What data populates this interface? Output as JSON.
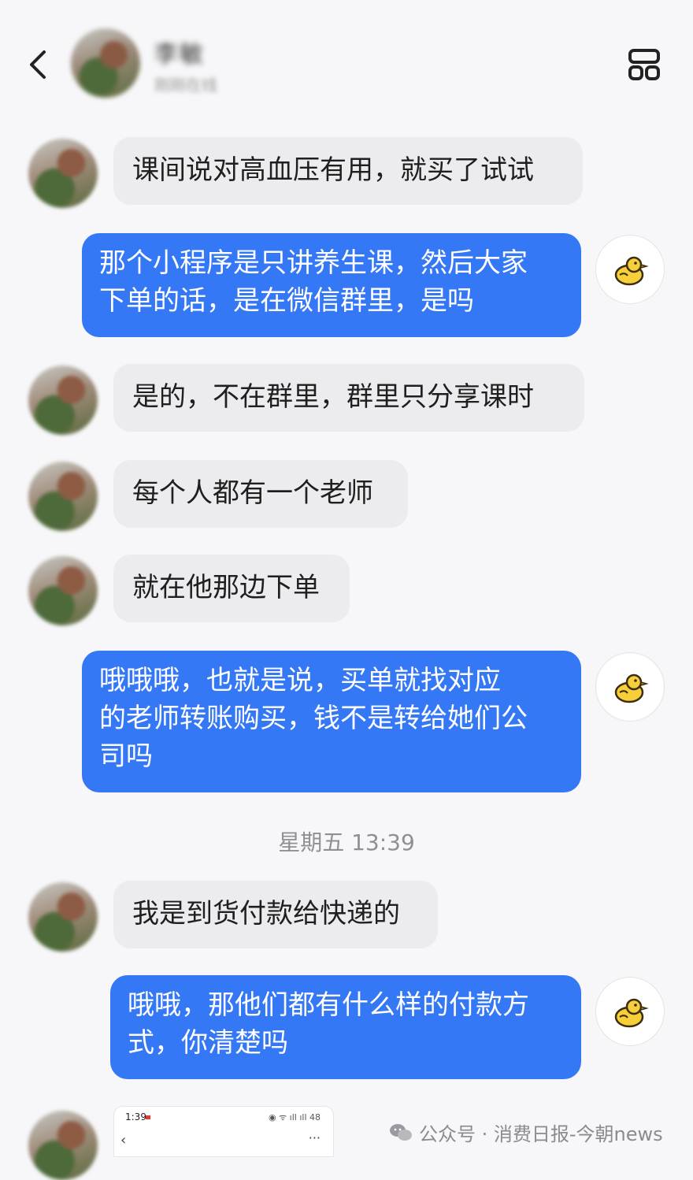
{
  "header": {
    "contact_name": "李敏",
    "contact_status": "刚刚在线"
  },
  "messages": [
    {
      "from": "other",
      "text": "课间说对高血压有用，就买了试试"
    },
    {
      "from": "self",
      "lines": [
        "那个小程序是只讲养生课，然后大家",
        "下单的话，是在微信群里，是吗"
      ]
    },
    {
      "from": "other",
      "text": "是的，不在群里，群里只分享课时"
    },
    {
      "from": "other",
      "text": "每个人都有一个老师"
    },
    {
      "from": "other",
      "text": "就在他那边下单"
    },
    {
      "from": "self",
      "lines": [
        "哦哦哦，也就是说，买单就找对应",
        "的老师转账购买，钱不是转给她们公",
        "司吗"
      ]
    },
    {
      "from": "other",
      "text": "我是到货付款给快递的"
    },
    {
      "from": "self",
      "lines": [
        "哦哦，那他们都有什么样的付款方",
        "式，你清楚吗"
      ]
    }
  ],
  "timestamp": "星期五 13:39",
  "screenshot_message": {
    "time": "1:39",
    "status_icons": "◉ ᯤ ıll ıll 48",
    "back": "‹",
    "more": "···"
  },
  "watermark": "公众号 · 消费日报-今朝news",
  "colors": {
    "self_bubble": "#3578f6",
    "other_bubble": "#ececef",
    "background": "#f7f7f9"
  },
  "icons": {
    "back": "chevron-left-icon",
    "more": "grid-layout-icon",
    "self_avatar": "yellow-chick-icon"
  }
}
